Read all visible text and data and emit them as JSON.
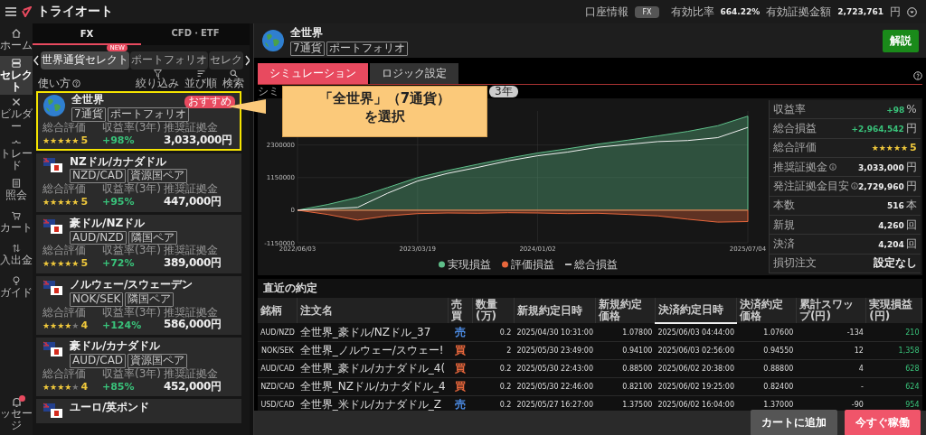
{
  "app": {
    "logo": "トライオート"
  },
  "nav": [
    {
      "label": "ホーム",
      "selected": false
    },
    {
      "label": "セレクト",
      "selected": true
    },
    {
      "label": "ビルダー",
      "selected": false
    },
    {
      "label": "トレード",
      "selected": false
    },
    {
      "label": "照会",
      "selected": false
    },
    {
      "label": "カート",
      "selected": false
    },
    {
      "label": "入出金",
      "selected": false
    },
    {
      "label": "ガイド",
      "selected": false
    }
  ],
  "message_nav": {
    "label": "ッセージ"
  },
  "list_tabs": [
    {
      "label": "FX",
      "selected": true
    },
    {
      "label": "CFD・ETF",
      "selected": false
    }
  ],
  "chips": [
    {
      "label": "世界通貨セレクト",
      "selected": true,
      "badge": "NEW"
    },
    {
      "label": "ポートフォリオ",
      "selected": false
    },
    {
      "label": "セレク",
      "selected": false
    }
  ],
  "howto": "使い方",
  "tools": [
    {
      "label": "絞り込み"
    },
    {
      "label": "並び順"
    },
    {
      "label": "検索"
    }
  ],
  "cards": [
    {
      "kind": "portfolio",
      "name": "全世界",
      "tags": [
        "7通貨",
        "ポートフォリオ"
      ],
      "badge": "おすすめ",
      "highlighted": true,
      "rating_label": "総合評価",
      "stars": 5,
      "rating": "5",
      "return_label": "収益率(3年)",
      "return": "+98%",
      "margin_label": "推奨証拠金",
      "margin": "3,033,000円"
    },
    {
      "kind": "pair",
      "name": "NZドル/カナダドル",
      "tags": [
        "NZD/CAD",
        "資源国ペア"
      ],
      "highlighted": false,
      "rating_label": "総合評価",
      "stars": 5,
      "rating": "5",
      "return_label": "収益率(3年)",
      "return": "+95%",
      "margin_label": "推奨証拠金",
      "margin": "447,000円"
    },
    {
      "kind": "pair",
      "name": "豪ドル/NZドル",
      "tags": [
        "AUD/NZD",
        "隣国ペア"
      ],
      "highlighted": false,
      "rating_label": "総合評価",
      "stars": 5,
      "rating": "5",
      "return_label": "収益率(3年)",
      "return": "+72%",
      "margin_label": "推奨証拠金",
      "margin": "389,000円"
    },
    {
      "kind": "pair",
      "name": "ノルウェー/スウェーデン",
      "tags": [
        "NOK/SEK",
        "隣国ペア"
      ],
      "highlighted": false,
      "rating_label": "総合評価",
      "stars": 4,
      "rating": "4",
      "return_label": "収益率(3年)",
      "return": "+124%",
      "margin_label": "推奨証拠金",
      "margin": "586,000円"
    },
    {
      "kind": "pair",
      "name": "豪ドル/カナダドル",
      "tags": [
        "AUD/CAD",
        "資源国ペア"
      ],
      "highlighted": false,
      "rating_label": "総合評価",
      "stars": 4,
      "rating": "4",
      "return_label": "収益率(3年)",
      "return": "+85%",
      "margin_label": "推奨証拠金",
      "margin": "452,000円"
    },
    {
      "kind": "pair",
      "name": "ユーロ/英ポンド",
      "highlighted": false
    }
  ],
  "account": {
    "label": "口座情報",
    "pill": "FX",
    "ratio_label": "有効比率",
    "ratio": "664.22%",
    "equity_label": "有効証拠金額",
    "equity": "2,723,761",
    "equity_unit": "円"
  },
  "product": {
    "kind": "portfolio",
    "name": "全世界",
    "tags": [
      "7通貨",
      "ポートフォリオ"
    ],
    "button": "解説"
  },
  "main_tabs": [
    {
      "label": "シミュレーション",
      "selected": true
    },
    {
      "label": "ロジック設定",
      "selected": false
    }
  ],
  "sim_label": "シミ",
  "period": "3年",
  "callout": {
    "lines": [
      "「全世界」（7通貨）",
      "を選択"
    ]
  },
  "chart_data": {
    "type": "area",
    "grid": true,
    "legend": "bottom",
    "categories": [
      "2022/06/03",
      null,
      null,
      null,
      "2023/03/19",
      null,
      null,
      null,
      "2024/01/02",
      null,
      null,
      null,
      null,
      null,
      null,
      "2025/07/04"
    ],
    "ylim": [
      -1150000,
      3500000
    ],
    "yticks": [
      -1150000,
      0,
      1150000,
      2300000
    ],
    "series": [
      {
        "name": "実現損益",
        "color": "#5fbf8a",
        "values": [
          0,
          200000,
          450000,
          800000,
          1150000,
          1400000,
          1620000,
          1830000,
          2020000,
          2170000,
          2330000,
          2470000,
          2620000,
          2780000,
          2980000,
          3320000
        ]
      },
      {
        "name": "評価損益",
        "color": "#e8673c",
        "values": [
          0,
          -150000,
          -350000,
          -200000,
          -120000,
          -100000,
          -110000,
          -90000,
          -100000,
          -120000,
          -110000,
          -150000,
          -200000,
          -320000,
          -420000,
          -400000
        ]
      },
      {
        "name": "総合損益",
        "color": "#f0f0f0",
        "type": "line",
        "values": [
          0,
          50000,
          100000,
          600000,
          1030000,
          1300000,
          1510000,
          1740000,
          1920000,
          2050000,
          2220000,
          2320000,
          2420000,
          2460000,
          2560000,
          2920000
        ]
      }
    ]
  },
  "stats": [
    {
      "kind": "gain",
      "label": "収益率",
      "value": "+98",
      "unit": "%"
    },
    {
      "kind": "gain",
      "label": "総合損益",
      "value": "+2,964,542",
      "unit": "円"
    },
    {
      "kind": "stars",
      "label": "総合評価",
      "stars": 5,
      "value": "5"
    },
    {
      "kind": "plain",
      "label": "推奨証拠金",
      "info": true,
      "value": "3,033,000",
      "unit": "円"
    },
    {
      "kind": "plain",
      "label": "発注証拠金目安",
      "info": true,
      "value": "2,729,960",
      "unit": "円"
    },
    {
      "kind": "plain",
      "label": "本数",
      "value": "516",
      "unit": "本"
    },
    {
      "kind": "plain",
      "label": "新規",
      "value": "4,260",
      "unit": "回"
    },
    {
      "kind": "plain",
      "label": "決済",
      "value": "4,204",
      "unit": "回"
    },
    {
      "kind": "plain",
      "label": "損切注文",
      "value": "設定なし"
    }
  ],
  "trades": {
    "title": "直近の約定",
    "columns": [
      {
        "label": "銘柄",
        "sorted": false
      },
      {
        "label": "注文名",
        "sorted": false
      },
      {
        "label": "売買",
        "sorted": false
      },
      {
        "label": "数量(万)",
        "sorted": false
      },
      {
        "label": "新規約定日時",
        "sorted": false
      },
      {
        "label": "新規約定価格",
        "sorted": false
      },
      {
        "label": "決済約定日時",
        "sorted": true
      },
      {
        "label": "決済約定価格",
        "sorted": false
      },
      {
        "label": "累計スワップ(円)",
        "sorted": false
      },
      {
        "label": "実現損益(円)",
        "sorted": false
      }
    ],
    "rows": [
      {
        "pair": "AUD/NZD",
        "order": "全世界_豪ドル/NZドル_37",
        "side": "売",
        "color": "#4d8ee8",
        "qty": "0.2",
        "open_time": "2025/04/30 10:31:00",
        "open_price": "1.07800",
        "close_time": "2025/06/03 04:44:00",
        "close_price": "1.07600",
        "swap": "-134",
        "pnl": "210"
      },
      {
        "pair": "NOK/SEK",
        "order": "全世界_ノルウェー/スウェー!",
        "side": "買",
        "color": "#e8673c",
        "qty": "2",
        "open_time": "2025/05/30 23:49:00",
        "open_price": "0.94100",
        "close_time": "2025/06/03 02:56:00",
        "close_price": "0.94550",
        "swap": "12",
        "pnl": "1,358"
      },
      {
        "pair": "AUD/CAD",
        "order": "全世界_豪ドル/カナダドル_4(",
        "side": "買",
        "color": "#e8673c",
        "qty": "0.2",
        "open_time": "2025/05/30 22:43:00",
        "open_price": "0.88500",
        "close_time": "2025/06/02 20:38:00",
        "close_price": "0.88800",
        "swap": "4",
        "pnl": "628"
      },
      {
        "pair": "NZD/CAD",
        "order": "全世界_NZドル/カナダドル_4",
        "side": "買",
        "color": "#e8673c",
        "qty": "0.2",
        "open_time": "2025/05/30 22:46:00",
        "open_price": "0.82100",
        "close_time": "2025/06/02 19:25:00",
        "close_price": "0.82400",
        "swap": "-",
        "pnl": "624"
      },
      {
        "pair": "USD/CAD",
        "order": "全世界_米ドル/カナダドル_Z",
        "side": "売",
        "color": "#4d8ee8",
        "qty": "0.2",
        "open_time": "2025/05/27 16:27:00",
        "open_price": "1.37500",
        "close_time": "2025/06/02 16:04:00",
        "close_price": "1.37000",
        "swap": "-90",
        "pnl": "954"
      }
    ]
  },
  "footer": {
    "cart_button": "カートに追加",
    "start_button": "今すぐ稼働"
  }
}
